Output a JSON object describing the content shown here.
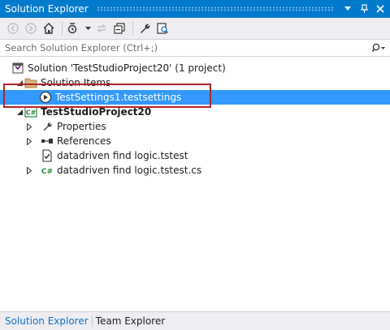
{
  "window": {
    "title": "Solution Explorer",
    "accent_color": "#007acc"
  },
  "search": {
    "placeholder": "Search Solution Explorer (Ctrl+;)"
  },
  "tree": {
    "selected_color": "#3399ff",
    "highlight_color": "#b0252a",
    "items": [
      {
        "label": "Solution 'TestStudioProject20' (1 project)",
        "icon": "solution-icon",
        "expander": "none",
        "bold": false
      },
      {
        "label": "Solution Items",
        "icon": "folder-icon",
        "expander": "expanded",
        "bold": false
      },
      {
        "label": "TestSettings1.testsettings",
        "icon": "testsettings-icon",
        "expander": "none",
        "bold": false,
        "selected": true
      },
      {
        "label": "TestStudioProject20",
        "icon": "csharp-project-icon",
        "expander": "expanded",
        "bold": true
      },
      {
        "label": "Properties",
        "icon": "wrench-icon",
        "expander": "collapsed",
        "bold": false
      },
      {
        "label": "References",
        "icon": "references-icon",
        "expander": "collapsed",
        "bold": false
      },
      {
        "label": "datadriven find logic.tstest",
        "icon": "test-file-icon",
        "expander": "none",
        "bold": false
      },
      {
        "label": "datadriven find logic.tstest.cs",
        "icon": "csharp-file-icon",
        "expander": "collapsed",
        "bold": false
      }
    ]
  },
  "bottom_tabs": [
    {
      "label": "Solution Explorer",
      "active": true
    },
    {
      "label": "Team Explorer",
      "active": false
    }
  ]
}
